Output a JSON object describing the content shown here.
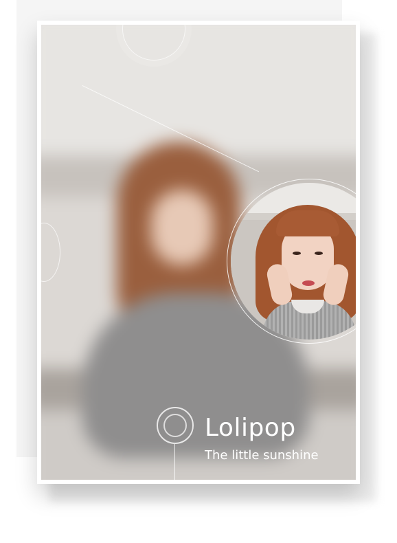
{
  "poster": {
    "title": "Lolipop",
    "subtitle": "The little sunshine"
  },
  "colors": {
    "text": "#ffffff",
    "hair": "#a2562f",
    "background_wall": "#e7e5e2"
  }
}
